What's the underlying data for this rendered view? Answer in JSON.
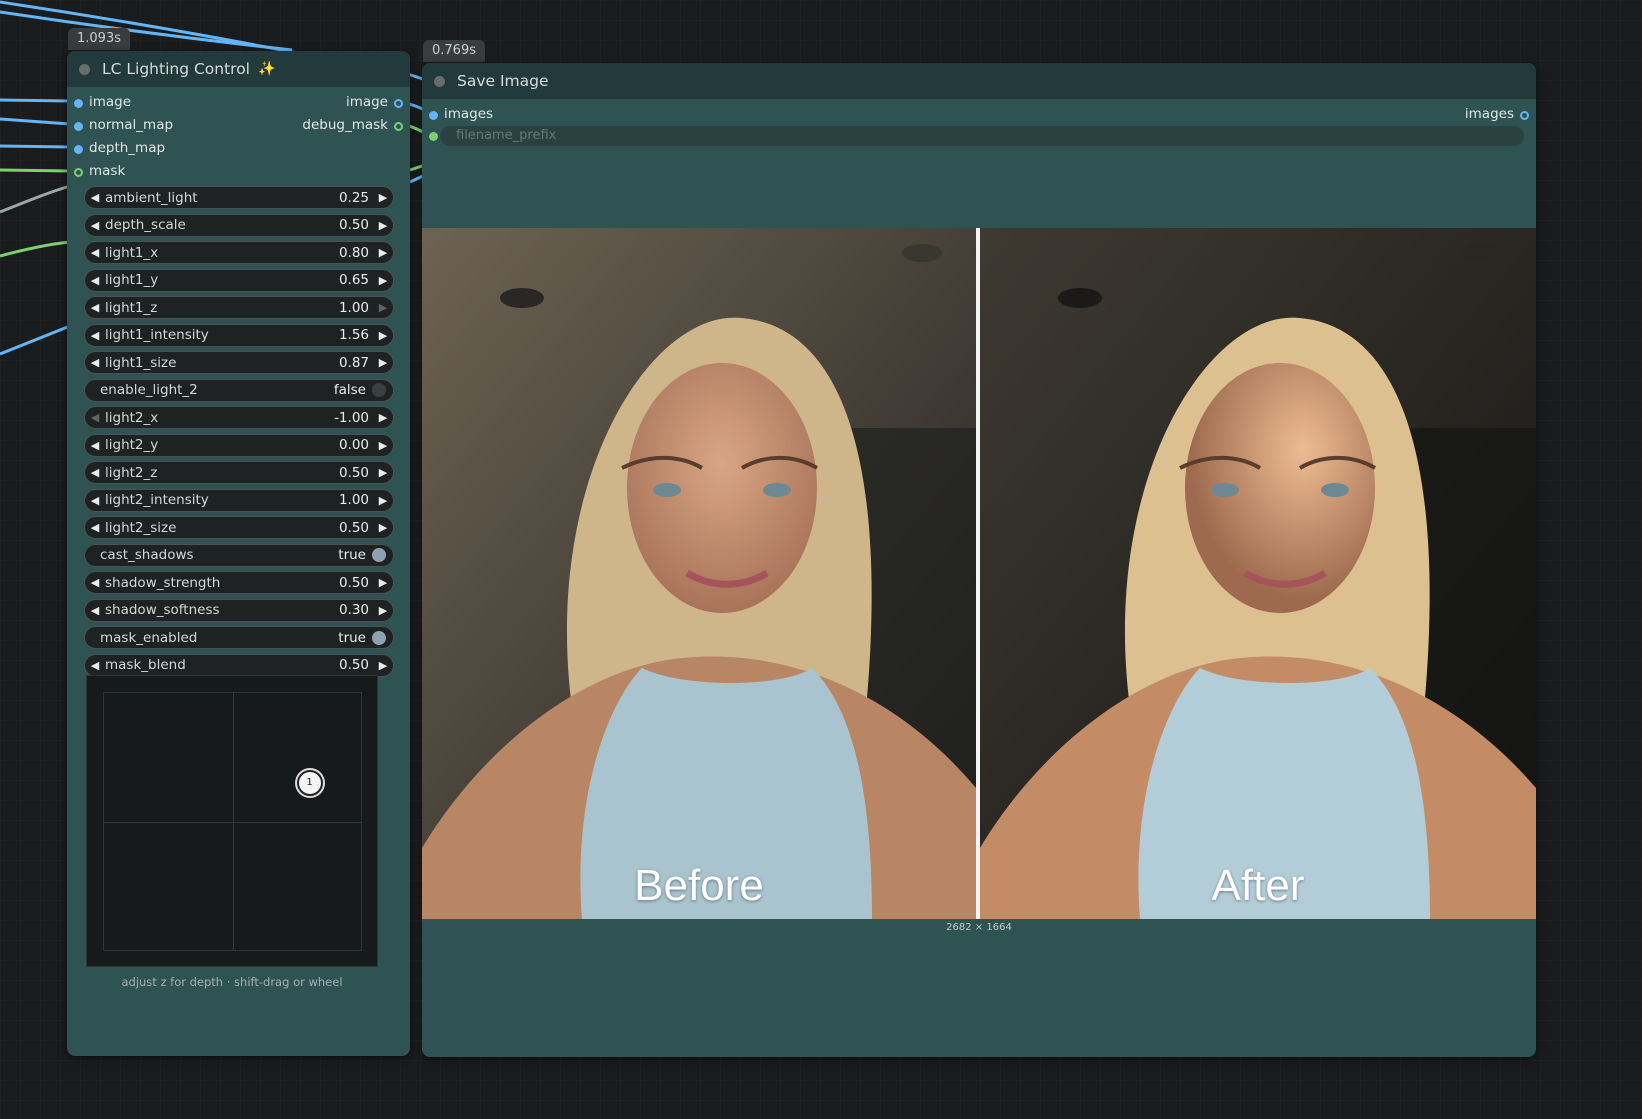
{
  "timers": {
    "lighting": "1.093s",
    "save": "0.769s"
  },
  "lighting_node": {
    "title": "LC Lighting Control",
    "title_icon": "magic-wand-icon",
    "inputs": [
      {
        "label": "image",
        "type": "IMAGE"
      },
      {
        "label": "normal_map",
        "type": "IMAGE"
      },
      {
        "label": "depth_map",
        "type": "IMAGE"
      },
      {
        "label": "mask",
        "type": "MASK"
      }
    ],
    "outputs": [
      {
        "label": "image"
      },
      {
        "label": "debug_mask"
      }
    ],
    "widgets": [
      {
        "label": "ambient_light",
        "value": "0.25",
        "kind": "number",
        "left_enabled": true,
        "right_enabled": true
      },
      {
        "label": "depth_scale",
        "value": "0.50",
        "kind": "number",
        "left_enabled": true,
        "right_enabled": true
      },
      {
        "label": "light1_x",
        "value": "0.80",
        "kind": "number",
        "left_enabled": true,
        "right_enabled": true
      },
      {
        "label": "light1_y",
        "value": "0.65",
        "kind": "number",
        "left_enabled": true,
        "right_enabled": true
      },
      {
        "label": "light1_z",
        "value": "1.00",
        "kind": "number",
        "left_enabled": true,
        "right_enabled": false
      },
      {
        "label": "light1_intensity",
        "value": "1.56",
        "kind": "number",
        "left_enabled": true,
        "right_enabled": true
      },
      {
        "label": "light1_size",
        "value": "0.87",
        "kind": "number",
        "left_enabled": true,
        "right_enabled": true
      },
      {
        "label": "enable_light_2",
        "value": "false",
        "kind": "toggle",
        "on": false
      },
      {
        "label": "light2_x",
        "value": "-1.00",
        "kind": "number",
        "left_enabled": false,
        "right_enabled": true
      },
      {
        "label": "light2_y",
        "value": "0.00",
        "kind": "number",
        "left_enabled": true,
        "right_enabled": true
      },
      {
        "label": "light2_z",
        "value": "0.50",
        "kind": "number",
        "left_enabled": true,
        "right_enabled": true
      },
      {
        "label": "light2_intensity",
        "value": "1.00",
        "kind": "number",
        "left_enabled": true,
        "right_enabled": true
      },
      {
        "label": "light2_size",
        "value": "0.50",
        "kind": "number",
        "left_enabled": true,
        "right_enabled": true
      },
      {
        "label": "cast_shadows",
        "value": "true",
        "kind": "toggle",
        "on": true
      },
      {
        "label": "shadow_strength",
        "value": "0.50",
        "kind": "number",
        "left_enabled": true,
        "right_enabled": true
      },
      {
        "label": "shadow_softness",
        "value": "0.30",
        "kind": "number",
        "left_enabled": true,
        "right_enabled": true
      },
      {
        "label": "mask_enabled",
        "value": "true",
        "kind": "toggle",
        "on": true
      },
      {
        "label": "mask_blend",
        "value": "0.50",
        "kind": "number",
        "left_enabled": true,
        "right_enabled": true
      }
    ],
    "light_pad": {
      "handle_label": "1",
      "handle_x": 0.8,
      "handle_y": 0.65,
      "hint": "adjust z for depth · shift-drag or wheel"
    }
  },
  "save_node": {
    "title": "Save Image",
    "input_label": "images",
    "output_label": "images",
    "filename_placeholder": "filename_prefix",
    "before_label": "Before",
    "after_label": "After",
    "dimensions": "2682 × 1664"
  },
  "colors": {
    "canvas": "#191b1c",
    "node_body": "#2f5253",
    "node_title": "#223a3b",
    "image_wire": "#64b5f6",
    "mask_wire": "#7dd06f"
  }
}
